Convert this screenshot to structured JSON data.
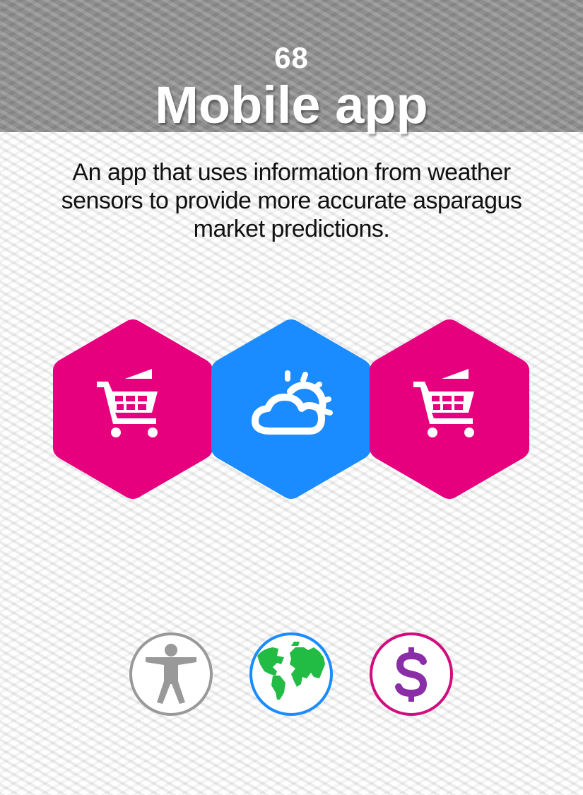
{
  "card": {
    "number": "68",
    "title": "Mobile app",
    "description": "An app that uses information from weather sensors to provide more accurate asparagus market predictions."
  },
  "hexagons": [
    {
      "icon": "shopping-cart-icon",
      "color": "#e6007e"
    },
    {
      "icon": "weather-cloud-sun-icon",
      "color": "#1a8cff"
    },
    {
      "icon": "shopping-cart-icon",
      "color": "#e6007e"
    }
  ],
  "categories": [
    {
      "icon": "person-accessibility-icon",
      "color": "#999999"
    },
    {
      "icon": "globe-earth-icon",
      "color": "#1a8cff"
    },
    {
      "icon": "dollar-sign-icon",
      "color": "#d10d7e"
    }
  ]
}
